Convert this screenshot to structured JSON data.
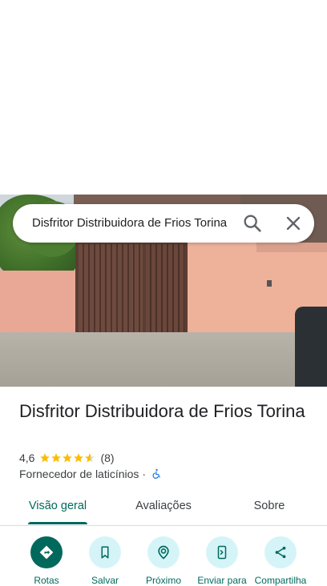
{
  "search": {
    "query": "Disfritor Distribuidora de Frios Torina"
  },
  "place": {
    "name": "Disfritor Distribuidora de Frios Torina",
    "rating": "4,6",
    "rating_value": 4.6,
    "review_count": "(8)",
    "category": "Fornecedor de laticínios",
    "separator": "·"
  },
  "tabs": [
    {
      "label": "Visão geral",
      "active": true
    },
    {
      "label": "Avaliações",
      "active": false
    },
    {
      "label": "Sobre",
      "active": false
    }
  ],
  "actions": [
    {
      "label": "Rotas",
      "icon": "directions-icon"
    },
    {
      "label": "Salvar",
      "icon": "bookmark-icon"
    },
    {
      "label": "Próximo",
      "icon": "nearby-icon"
    },
    {
      "label": "Enviar para",
      "icon": "send-to-phone-icon"
    },
    {
      "label": "Compartilha",
      "icon": "share-icon"
    }
  ],
  "colors": {
    "accent": "#00695c",
    "action_bg": "#d5f4f8",
    "star": "#fbbc04",
    "accessibility": "#1a73e8"
  }
}
